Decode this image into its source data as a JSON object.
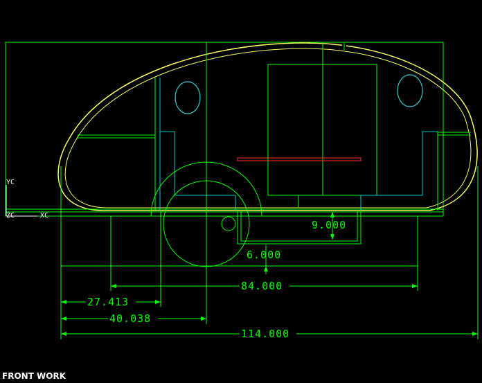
{
  "view": {
    "label": "FRONT WORK"
  },
  "axes": {
    "yc": "YC",
    "zc": "ZC",
    "xc": "XC"
  },
  "dimensions": {
    "d9": "9.000",
    "d6": "6.000",
    "d84": "84.000",
    "d27": "27.413",
    "d40": "40.038",
    "d114": "114.000"
  },
  "colors": {
    "background": "#000000",
    "geometry": "#00ff00",
    "shell": "#ffff66",
    "windows": "#33cccc",
    "cabinet": "#00cccc",
    "bed": "#ff3333",
    "axis": "#ffffff",
    "label": "#ffffff"
  }
}
